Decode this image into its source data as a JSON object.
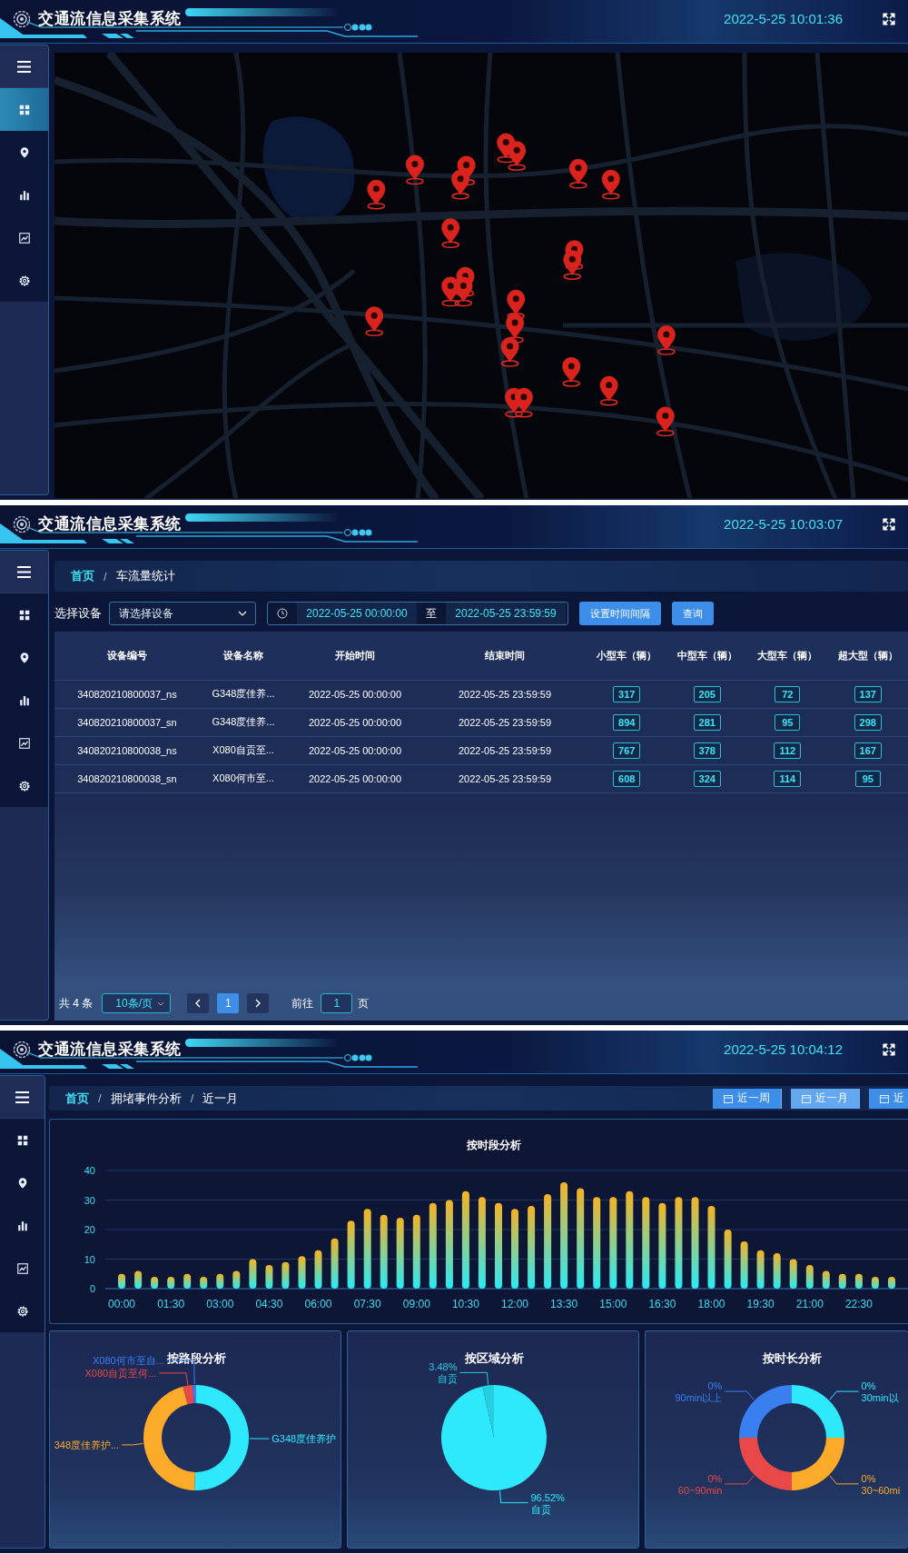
{
  "screens": [
    {
      "kind": "map",
      "header": {
        "title": "交通流信息采集系统",
        "time": "2022-5-25 10:01:36"
      },
      "sidebar": {
        "items": [
          {
            "selected": true
          },
          {
            "selected": false
          },
          {
            "selected": false
          },
          {
            "selected": false
          },
          {
            "selected": false
          }
        ]
      }
    },
    {
      "kind": "table",
      "header": {
        "title": "交通流信息采集系统",
        "time": "2022-5-25 10:03:07"
      },
      "sidebar": {
        "items": [
          {
            "selected": false
          },
          {
            "selected": false
          },
          {
            "selected": false
          },
          {
            "selected": false
          },
          {
            "selected": false
          }
        ]
      },
      "breadcrumb": {
        "separator": "/",
        "items": [
          "首页",
          "车流量统计"
        ]
      },
      "filters": {
        "device_label": "选择设备",
        "device_select": {
          "placeholder": "请选择设备"
        },
        "date_start": "2022-05-25 00:00:00",
        "date_separator": "至",
        "date_end": "2022-05-25 23:59:59",
        "buttons": [
          "设置时间间隔",
          "查询"
        ]
      },
      "table": {
        "columns": [
          {
            "label": "设备编号",
            "kind": "text"
          },
          {
            "label": "设备名称",
            "kind": "text"
          },
          {
            "label": "开始时间",
            "kind": "text"
          },
          {
            "label": "结束时间",
            "kind": "text"
          },
          {
            "label": "小型车（辆）",
            "kind": "count"
          },
          {
            "label": "中型车（辆）",
            "kind": "count"
          },
          {
            "label": "大型车（辆）",
            "kind": "count"
          },
          {
            "label": "超大型（辆）",
            "kind": "count"
          }
        ],
        "rows": [
          [
            "340820210800037_ns",
            "G348度佳养...",
            "2022-05-25 00:00:00",
            "2022-05-25 23:59:59",
            "317",
            "205",
            "72",
            "137"
          ],
          [
            "340820210800037_sn",
            "G348度佳养...",
            "2022-05-25 00:00:00",
            "2022-05-25 23:59:59",
            "894",
            "281",
            "95",
            "298"
          ],
          [
            "340820210800038_ns",
            "X080自贡至...",
            "2022-05-25 00:00:00",
            "2022-05-25 23:59:59",
            "767",
            "378",
            "112",
            "167"
          ],
          [
            "340820210800038_sn",
            "X080何市至...",
            "2022-05-25 00:00:00",
            "2022-05-25 23:59:59",
            "608",
            "324",
            "114",
            "95"
          ]
        ]
      },
      "pagination": {
        "total": "共 4 条",
        "page_size": "10条/页",
        "pages": [
          {
            "label": "1",
            "selected": true
          }
        ],
        "goto_label": "前往",
        "goto_value": "1",
        "goto_suffix": "页"
      }
    },
    {
      "kind": "analysis",
      "header": {
        "title": "交通流信息采集系统",
        "time": "2022-5-25 10:04:12"
      },
      "sidebar": {
        "items": [
          {
            "selected": false
          },
          {
            "selected": false
          },
          {
            "selected": false
          },
          {
            "selected": false
          },
          {
            "selected": false
          }
        ]
      },
      "breadcrumb": {
        "separator": "/",
        "items": [
          "首页",
          "拥堵事件分析",
          "近一月"
        ]
      },
      "range_buttons": [
        {
          "label": "近一周",
          "selected": false
        },
        {
          "label": "近一月",
          "selected": true
        },
        {
          "label": "近",
          "selected": false
        }
      ],
      "time_chart": {
        "chart_data": {
          "type": "bar",
          "title": "按时段分析",
          "grid": true,
          "x": [
            0,
            0.5,
            1,
            1.5,
            2,
            2.5,
            3,
            3.5,
            4,
            4.5,
            5,
            5.5,
            6,
            6.5,
            7,
            7.5,
            8,
            8.5,
            9,
            9.5,
            10,
            10.5,
            11,
            11.5,
            12,
            12.5,
            13,
            13.5,
            14,
            14.5,
            15,
            15.5,
            16,
            16.5,
            17,
            17.5,
            18,
            18.5,
            19,
            19.5,
            20,
            20.5,
            21,
            21.5,
            22,
            22.5,
            23,
            23.5
          ],
          "values": [
            5,
            6,
            4,
            4,
            5,
            4,
            5,
            6,
            10,
            8,
            9,
            11,
            13,
            17,
            23,
            27,
            25,
            24,
            25,
            29,
            30,
            33,
            31,
            29,
            27,
            28,
            32,
            36,
            34,
            31,
            31,
            33,
            31,
            29,
            31,
            31,
            28,
            20,
            16,
            13,
            12,
            10,
            8,
            6,
            5,
            5,
            4,
            4
          ],
          "xlim": [
            -0.5,
            24
          ],
          "ylim": [
            0,
            40
          ],
          "yticks": [
            0,
            10,
            20,
            30,
            40
          ],
          "xticks": [
            {
              "value": 0,
              "label": "00:00"
            },
            {
              "value": 1.5,
              "label": "01:30"
            },
            {
              "value": 3,
              "label": "03:00"
            },
            {
              "value": 4.5,
              "label": "04:30"
            },
            {
              "value": 6,
              "label": "06:00"
            },
            {
              "value": 7.5,
              "label": "07:30"
            },
            {
              "value": 9,
              "label": "09:00"
            },
            {
              "value": 10.5,
              "label": "10:30"
            },
            {
              "value": 12,
              "label": "12:00"
            },
            {
              "value": 13.5,
              "label": "13:30"
            },
            {
              "value": 15,
              "label": "15:00"
            },
            {
              "value": 16.5,
              "label": "16:30"
            },
            {
              "value": 18,
              "label": "18:00"
            },
            {
              "value": 19.5,
              "label": "19:30"
            },
            {
              "value": 21,
              "label": "21:00"
            },
            {
              "value": 22.5,
              "label": "22:30"
            }
          ]
        }
      },
      "pies": [
        {
          "chart_data": {
            "type": "donut",
            "title": "按路段分析",
            "categories": [
              "G348度佳养护",
              "348度佳养护...",
              "X080自贡至何...",
              "X080何市至自..."
            ],
            "values": [
              50.5,
              45.5,
              3,
              1
            ],
            "colors": [
              "#2ee8fb",
              "#fcaa2a",
              "#e84848",
              "#3a7ff0"
            ]
          }
        },
        {
          "chart_data": {
            "type": "pie",
            "title": "按区域分析",
            "categories": [
              "自贡",
              "自贡"
            ],
            "values": [
              96.52,
              3.48
            ],
            "colors": [
              "#2ee8fb",
              "#25cfe0"
            ],
            "value_labels": [
              "96.52%",
              "3.48%"
            ]
          }
        },
        {
          "title": "按时长分析",
          "segments": [
            {
              "name": "90min以上",
              "value_label": "0%",
              "color": "#3a7ff0"
            },
            {
              "name": "30min以",
              "value_label": "0%",
              "color": "#2ee8fb"
            },
            {
              "name": "60~90min",
              "value_label": "0%",
              "color": "#e84848"
            },
            {
              "name": "30~60mi",
              "value_label": "0%",
              "color": "#fcaa2a"
            }
          ]
        }
      ]
    }
  ]
}
